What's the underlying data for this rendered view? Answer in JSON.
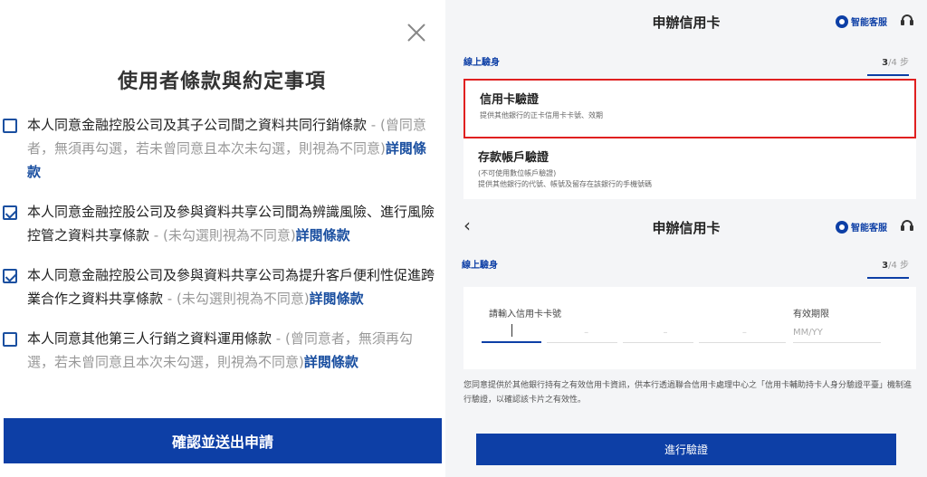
{
  "left": {
    "title": "使用者條款與約定事項",
    "terms": [
      {
        "checked": false,
        "main": "本人同意金融控股公司及其子公司間之資料共同行銷條款",
        "note": " - (曾同意者，無須再勾選，若未曾同意且本次未勾選，則視為不同意)",
        "link": "詳閱條款"
      },
      {
        "checked": true,
        "main": "本人同意金融控股公司及參與資料共享公司間為辨識風險、進行風險控管之資料共享條款",
        "note": " - (未勾選則視為不同意)",
        "link": "詳閱條款"
      },
      {
        "checked": true,
        "main": "本人同意金融控股公司及參與資料共享公司為提升客戶便利性促進跨業合作之資料共享條款",
        "note": " - (未勾選則視為不同意)",
        "link": "詳閱條款"
      },
      {
        "checked": false,
        "main": "本人同意其他第三人行銷之資料運用條款",
        "note": " - (曾同意者，無須再勾選，若未曾同意且本次未勾選，則視為不同意)",
        "link": "詳閱條款"
      }
    ],
    "confirm_label": "確認並送出申請"
  },
  "right": {
    "top": {
      "title": "申辦信用卡",
      "service_label": "智能客服",
      "step_label": "線上驗身",
      "step_current": "3",
      "step_total": "/4 步",
      "options": [
        {
          "title": "信用卡驗證",
          "desc": "提供其他銀行的正卡信用卡卡號、效期"
        },
        {
          "title": "存款帳戶驗證",
          "desc1": "(不可使用數位帳戶驗證)",
          "desc2": "提供其他銀行的代號、帳號及留存在該銀行的手機號碼"
        }
      ]
    },
    "bottom": {
      "back": "‹",
      "title": "申辦信用卡",
      "service_label": "智能客服",
      "step_label": "線上驗身",
      "step_current": "3",
      "step_total": "/4 步",
      "card_number_label": "請輸入信用卡卡號",
      "expiry_label": "有效期限",
      "expiry_placeholder": "MM/YY",
      "disclaimer": "您同意提供於其他銀行持有之有效信用卡資訊，供本行透過聯合信用卡處理中心之「信用卡輔助持卡人身分驗證平臺」機制進行驗證，以確認該卡片之有效性。",
      "verify_label": "進行驗證"
    }
  },
  "colors": {
    "brand": "#0d3fa6",
    "highlight": "#e02020"
  },
  "icons": [
    "close-icon",
    "back-chevron-icon",
    "service-bot-icon",
    "headset-icon",
    "checkbox-checked-icon",
    "checkbox-unchecked-icon"
  ]
}
